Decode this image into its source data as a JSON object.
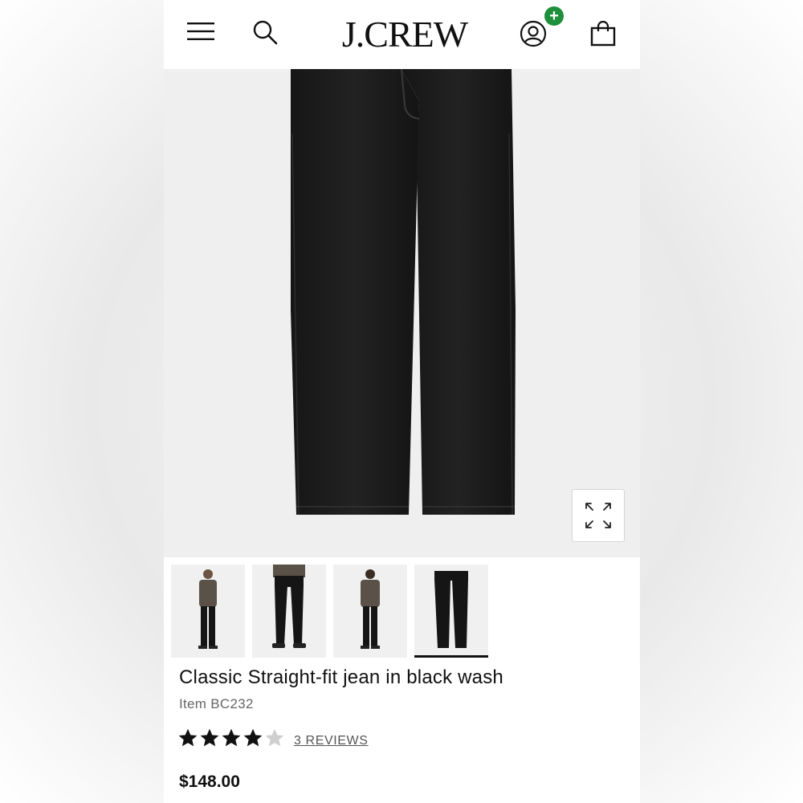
{
  "header": {
    "logo_text": "J.CREW",
    "menu_icon": "hamburger-menu-icon",
    "search_icon": "search-icon",
    "account_icon": "account-icon",
    "account_badge": "+",
    "bag_icon": "shopping-bag-icon",
    "badge_color": "#1e8f3c"
  },
  "hero": {
    "expand_icon": "expand-icon"
  },
  "thumbnails": {
    "count": 4,
    "selected_index": 3
  },
  "product": {
    "title": "Classic Straight-fit jean in black wash",
    "item_number": "Item BC232",
    "rating": 4,
    "rating_max": 5,
    "reviews_label": "3 REVIEWS",
    "price": "$148.00"
  }
}
